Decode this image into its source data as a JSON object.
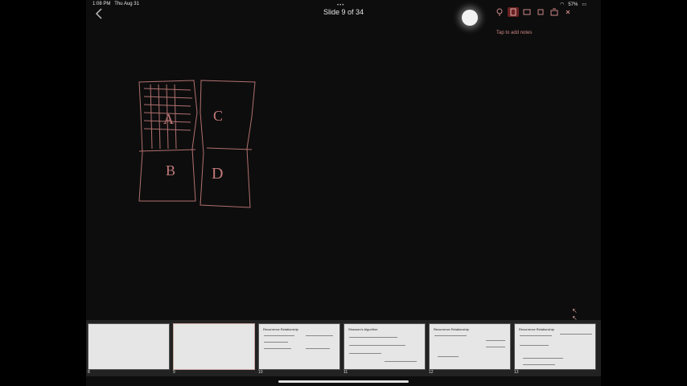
{
  "status_bar": {
    "time": "1:08 PM",
    "date": "Thu Aug 31",
    "battery": "57%"
  },
  "header": {
    "dots": "•••",
    "title": "Slide 9 of 34"
  },
  "notes_hint": "Tap to add notes",
  "sketch_labels": [
    "A",
    "C",
    "B",
    "D"
  ],
  "nav_arrows": "↖ ↖",
  "thumbnails": [
    {
      "number": "8",
      "title": ""
    },
    {
      "number": "9",
      "title": ""
    },
    {
      "number": "10",
      "title": "Recurrence Relationship"
    },
    {
      "number": "11",
      "title": "Strassen's Algorithm"
    },
    {
      "number": "12",
      "title": "Recurrence Relationship"
    },
    {
      "number": "13",
      "title": "Recurrence Relationship"
    }
  ],
  "colors": {
    "accent": "#6b2020",
    "ink": "#c47a7a",
    "background": "#0e0d0d"
  }
}
